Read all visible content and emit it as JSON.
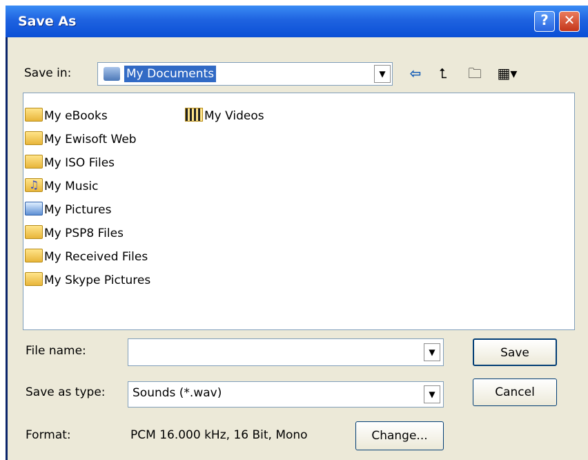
{
  "window": {
    "title": "Save As",
    "help_glyph": "?",
    "close_glyph": "✕"
  },
  "toolbar": {
    "save_in_label": "Save in:",
    "save_in_value": "My Documents",
    "dropdown_glyph": "▼",
    "back_glyph": "⇦",
    "up_glyph": "⮤",
    "new_folder_glyph": "🗀",
    "views_glyph": "▦▾"
  },
  "files": [
    {
      "label": "My eBooks",
      "icon": "folder-icon"
    },
    {
      "label": "My Ewisoft Web",
      "icon": "folder-icon"
    },
    {
      "label": "My ISO Files",
      "icon": "folder-icon"
    },
    {
      "label": "My Music",
      "icon": "music-folder-icon"
    },
    {
      "label": "My Pictures",
      "icon": "pictures-folder-icon"
    },
    {
      "label": "My PSP8 Files",
      "icon": "folder-icon"
    },
    {
      "label": "My Received Files",
      "icon": "folder-icon"
    },
    {
      "label": "My Skype Pictures",
      "icon": "folder-icon"
    },
    {
      "label": "My Videos",
      "icon": "videos-folder-icon"
    }
  ],
  "form": {
    "file_name_label": "File name:",
    "file_name_value": "",
    "save_type_label": "Save as type:",
    "save_type_value": "Sounds (*.wav)",
    "format_label": "Format:",
    "format_value": "PCM 16.000 kHz, 16 Bit, Mono",
    "change_label": "Change...",
    "save_label": "Save",
    "cancel_label": "Cancel"
  },
  "colors": {
    "title_bar": "#0a4fd6",
    "dialog_face": "#ece9d8",
    "selection": "#316ac5"
  }
}
